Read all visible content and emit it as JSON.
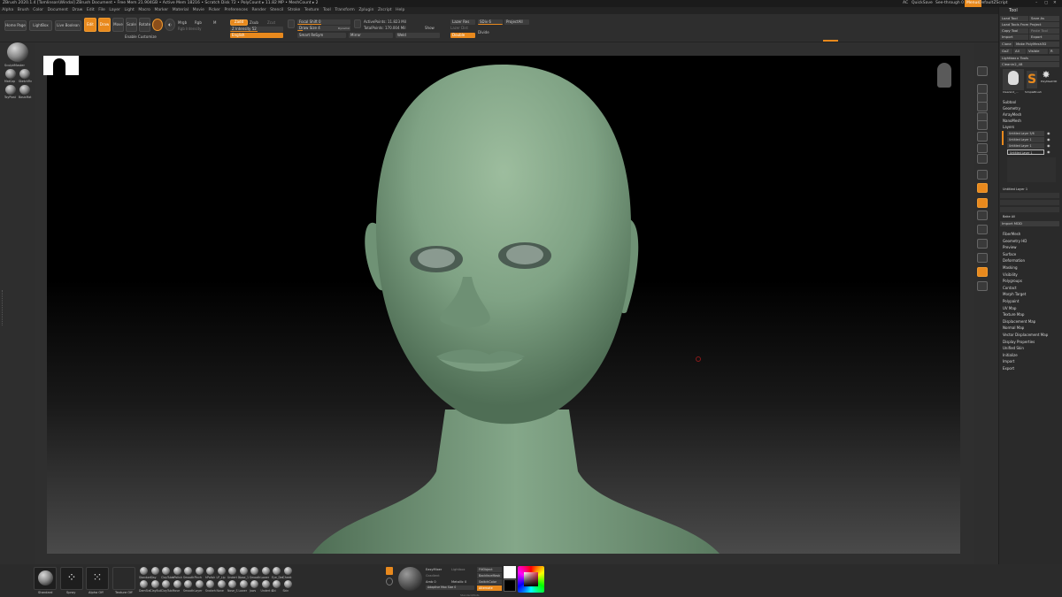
{
  "title_text": "ZBrush 2020.1.4 [Tomlinson\\Windal]  ZBrush Document  • Free Mem 21.904GB • Active Mem 18216 • Scratch Disk 72 • PolyCount ▸ 11.82 MP • MeshCount ▸ 2",
  "top_right": {
    "ac": "AC",
    "quicksave": "QuickSave",
    "seethrough": "See-through 0",
    "menus": "Menus",
    "script": "DefaultZScript"
  },
  "menus": [
    "Alpha",
    "Brush",
    "Color",
    "Document",
    "Draw",
    "Edit",
    "File",
    "Layer",
    "Light",
    "Macro",
    "Marker",
    "Material",
    "Movie",
    "Picker",
    "Preferences",
    "Render",
    "Stencil",
    "Stroke",
    "Texture",
    "Tool",
    "Transform",
    "Zplugin",
    "Zscript",
    "Help"
  ],
  "shelf": {
    "home_page": "Home Page",
    "lightbox": "LightBox",
    "live_boolean": "Live Boolean",
    "edit": "Edit",
    "draw": "Draw",
    "move": "Move",
    "scale": "Scale",
    "rotate": "Rotate",
    "mrgb": "Mrgb",
    "rgb": "Rgb",
    "m": "M",
    "zadd": "Zadd",
    "zsub": "Zsub",
    "zcut": "Zcut",
    "rgb_intensity": "Rgb Intensity",
    "z_intensity": "Z Intensity 52",
    "english": "English",
    "focal_shift": "Focal Shift 0",
    "draw_size": "Draw Size 4",
    "dynamic": "Dynamic",
    "active_points": "ActivePoints: 11.823 Mil",
    "total_points": "TotalPoints: 170.004 Mil",
    "smart_resym": "Smart ReSym",
    "mirror": "Mirror",
    "weld": "Weld",
    "show": "Show",
    "lazy_res": "Lazer Res",
    "sdiv": "SDiv 6",
    "project_all": "ProjectAll",
    "lazy_dist": "Lazer Dist",
    "double": "Double",
    "divide": "Divide",
    "enable_customize": "Enable Customize"
  },
  "left_panel": [
    "SculptMaster",
    "MatCap",
    "SketchFin",
    "ToyPlast",
    "BasicMat"
  ],
  "right_strip": [
    "BPR",
    "SPix 3",
    "Scroll",
    "Zoom",
    "Actual",
    "AAHalf",
    "Persp",
    "Floor",
    "Local",
    "Frame",
    "Move",
    "Scale",
    "Rotate",
    "PolyF",
    "Transp",
    "Ghost",
    "Solo",
    "Xpose"
  ],
  "tool_panel": {
    "header": "Tool",
    "load_tool": "Load Tool",
    "save_as": "Save As",
    "load_from_project": "Load Tools From Project",
    "copy_tool": "Copy Tool",
    "paste_tool": "Paste Tool",
    "import": "Import",
    "export": "Export",
    "clone": "Clone",
    "make_polymesh": "Make PolyMesh3D",
    "goz": "GoZ",
    "all": "All",
    "visible": "Visible",
    "r": "R",
    "lightbox_tools": "Lightbox ▸ Tools",
    "current_tool": "Cleanin2_48",
    "thumbs": [
      "Cleanin2_...",
      "PolyMesh3D",
      "SimpleBrush"
    ],
    "sections": [
      "Subtool",
      "Geometry",
      "ArrayMesh",
      "NanoMesh",
      "Layers"
    ],
    "layers": [
      "Untitled Layer 5/6",
      "Untitled Layer 1",
      "Untitled Layer 1",
      "Untitled Layer 1"
    ],
    "layer_name": "Untitled Layer 1",
    "bake_all": "Bake All",
    "import_mdd": "Import MDD",
    "sections2": [
      "FiberMesh",
      "Geometry HD",
      "Preview",
      "Surface",
      "Deformation",
      "Masking",
      "Visibility",
      "Polygroups",
      "Contact",
      "Morph Target",
      "Polypaint",
      "UV Map",
      "Texture Map",
      "Displacement Map",
      "Normal Map",
      "Vector Displacement Map",
      "Display Properties",
      "Unified Skin",
      "Initialize",
      "Import",
      "Export"
    ]
  },
  "bottom": {
    "standard": "Standard",
    "spray": "Spray",
    "alpha": "Alpha Off",
    "texture": "Texture Off",
    "brushes_row1": [
      "Standard",
      "Clay",
      "ClayTube",
      "hPolish",
      "Smooth",
      "Pinch",
      "hPolish",
      "LP_Lip",
      "Undert 1",
      "Nose_1",
      "Smooth",
      "Lower",
      "Eye_Det",
      "Cheek"
    ],
    "brushes_row2": [
      "DamStd",
      "ClayBuil",
      "ClayTub",
      "Move",
      "Smooth",
      "Layer",
      "Snakeh",
      "None",
      "Nose_S",
      "Lower",
      "Jaws",
      "Undert 4",
      "Ski",
      "Skin"
    ],
    "matcap_hint": "Lightbox",
    "easy_mixer": "EasyMixer",
    "gradient": "Gradient",
    "switch_color": "SwitchColor",
    "alternate": "Alternate",
    "fill_object": "FillObject",
    "backface_mask": "BackfaceMask",
    "ambient": "Amb 0",
    "metallic": "Metallic 0",
    "matcap_size": "Adaptive Max Size 0",
    "bottom_label": "Standard/Dots"
  },
  "colors": {
    "accent": "#e8891d",
    "panel": "#2e2e2e",
    "bg": "#2b2b2b"
  }
}
